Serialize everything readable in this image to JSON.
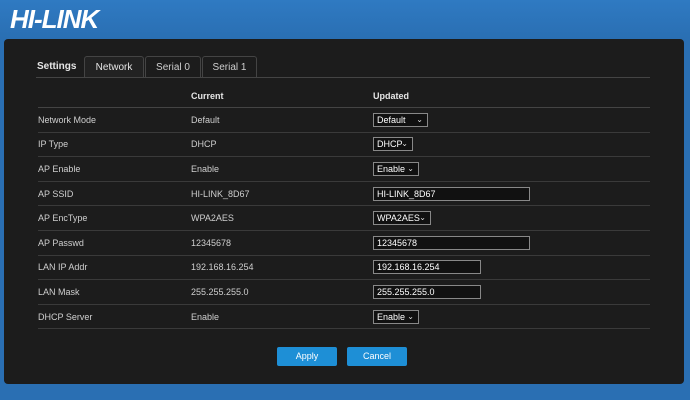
{
  "brand": {
    "logo_text": "HI-LINK"
  },
  "tabs": {
    "label": "Settings",
    "items": [
      {
        "label": "Network"
      },
      {
        "label": "Serial 0"
      },
      {
        "label": "Serial 1"
      }
    ]
  },
  "table": {
    "headers": [
      "",
      "Current",
      "Updated"
    ],
    "rows": [
      {
        "name": "Network Mode",
        "current": "Default",
        "updated": "Default",
        "control": "select"
      },
      {
        "name": "IP Type",
        "current": "DHCP",
        "updated": "DHCP",
        "control": "select"
      },
      {
        "name": "AP Enable",
        "current": "Enable",
        "updated": "Enable",
        "control": "select"
      },
      {
        "name": "AP SSID",
        "current": "HI-LINK_8D67",
        "updated": "HI-LINK_8D67",
        "control": "input"
      },
      {
        "name": "AP EncType",
        "current": "WPA2AES",
        "updated": "WPA2AES",
        "control": "select"
      },
      {
        "name": "AP Passwd",
        "current": "12345678",
        "updated": "12345678",
        "control": "input"
      },
      {
        "name": "LAN IP Addr",
        "current": "192.168.16.254",
        "updated": "192.168.16.254",
        "control": "input"
      },
      {
        "name": "LAN Mask",
        "current": "255.255.255.0",
        "updated": "255.255.255.0",
        "control": "input"
      },
      {
        "name": "DHCP Server",
        "current": "Enable",
        "updated": "Enable",
        "control": "select"
      }
    ]
  },
  "actions": {
    "apply_label": "Apply",
    "cancel_label": "Cancel"
  },
  "colors": {
    "header_blue": "#2a6fb3",
    "panel_bg": "#1c1c1c",
    "button_blue": "#1e8fd6"
  }
}
